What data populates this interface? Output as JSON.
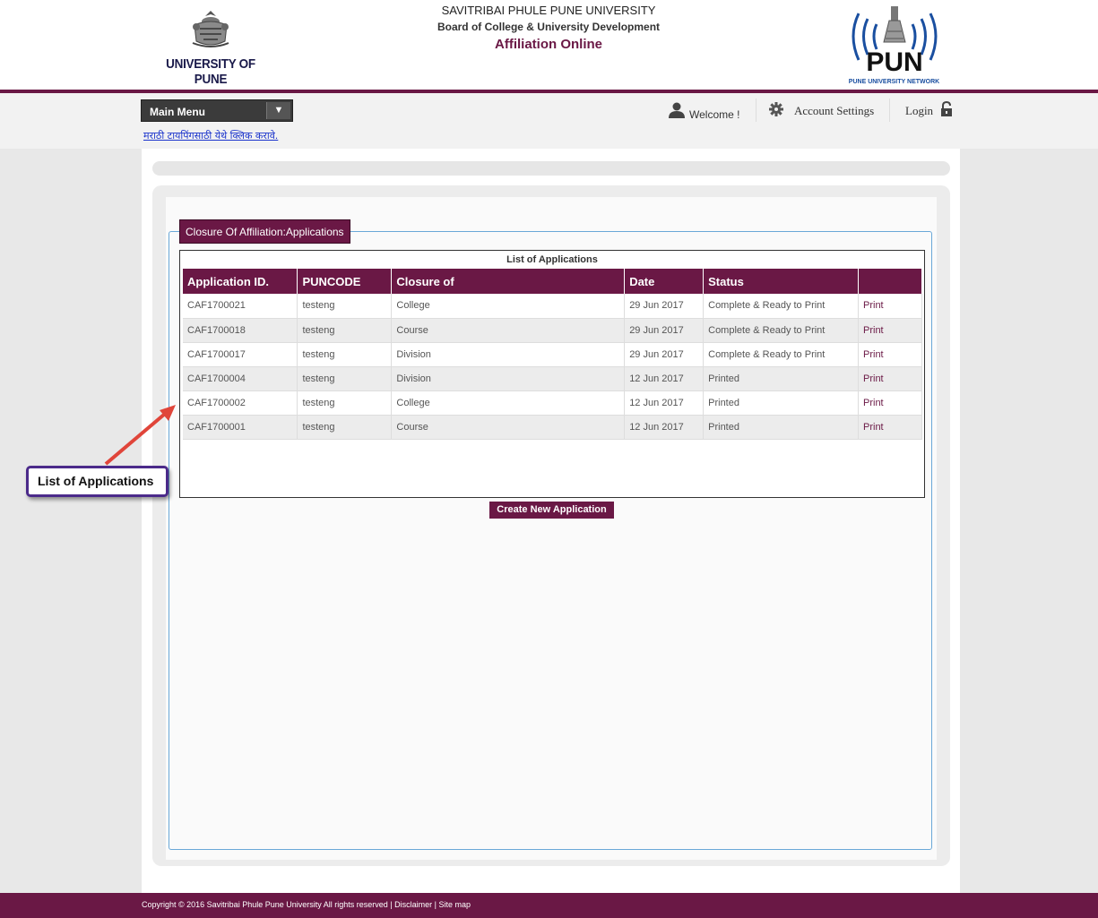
{
  "header": {
    "university_logo_text": "UNIVERSITY OF PUNE",
    "title_line1": "SAVITRIBAI PHULE PUNE UNIVERSITY",
    "title_line2": "Board of College & University Development",
    "title_line3": "Affiliation Online",
    "network_logo_text": "PUN",
    "network_caption": "PUNE UNIVERSITY NETWORK"
  },
  "nav": {
    "main_menu_label": "Main Menu",
    "marathi_link": "मराठी टायपिंगसाठी येथे क्लिक करावे.",
    "welcome_label": "Welcome !",
    "account_settings_label": "Account Settings",
    "login_label": "Login"
  },
  "section": {
    "legend": "Closure Of Affiliation:Applications",
    "list_caption": "List of Applications",
    "create_button": "Create New Application"
  },
  "table": {
    "headers": [
      "Application ID.",
      "PUNCODE",
      "Closure of",
      "Date",
      "Status",
      ""
    ],
    "rows": [
      {
        "id": "CAF1700021",
        "puncode": "testeng",
        "closure_of": "College",
        "date": "29 Jun 2017",
        "status": "Complete & Ready to Print",
        "action": "Print"
      },
      {
        "id": "CAF1700018",
        "puncode": "testeng",
        "closure_of": "Course",
        "date": "29 Jun 2017",
        "status": "Complete & Ready to Print",
        "action": "Print"
      },
      {
        "id": "CAF1700017",
        "puncode": "testeng",
        "closure_of": "Division",
        "date": "29 Jun 2017",
        "status": "Complete & Ready to Print",
        "action": "Print"
      },
      {
        "id": "CAF1700004",
        "puncode": "testeng",
        "closure_of": "Division",
        "date": "12 Jun 2017",
        "status": "Printed",
        "action": "Print"
      },
      {
        "id": "CAF1700002",
        "puncode": "testeng",
        "closure_of": "College",
        "date": "12 Jun 2017",
        "status": "Printed",
        "action": "Print"
      },
      {
        "id": "CAF1700001",
        "puncode": "testeng",
        "closure_of": "Course",
        "date": "12 Jun 2017",
        "status": "Printed",
        "action": "Print"
      }
    ]
  },
  "callout": {
    "label": "List of Applications"
  },
  "footer": {
    "text": "Copyright © 2016 Savitribai Phule Pune University All rights reserved | Disclaimer | Site map"
  },
  "colors": {
    "brand": "#6a1845",
    "page_bg": "#e8e8e8",
    "link": "#1a33cc",
    "callout_border": "#4b2a8a",
    "arrow": "#e0453a",
    "fieldset_border": "#6aa8d8"
  },
  "icons": [
    "university-crest-icon",
    "wifi-tower-icon",
    "dropdown-arrow-icon",
    "user-icon",
    "gear-icon",
    "lock-icon"
  ]
}
